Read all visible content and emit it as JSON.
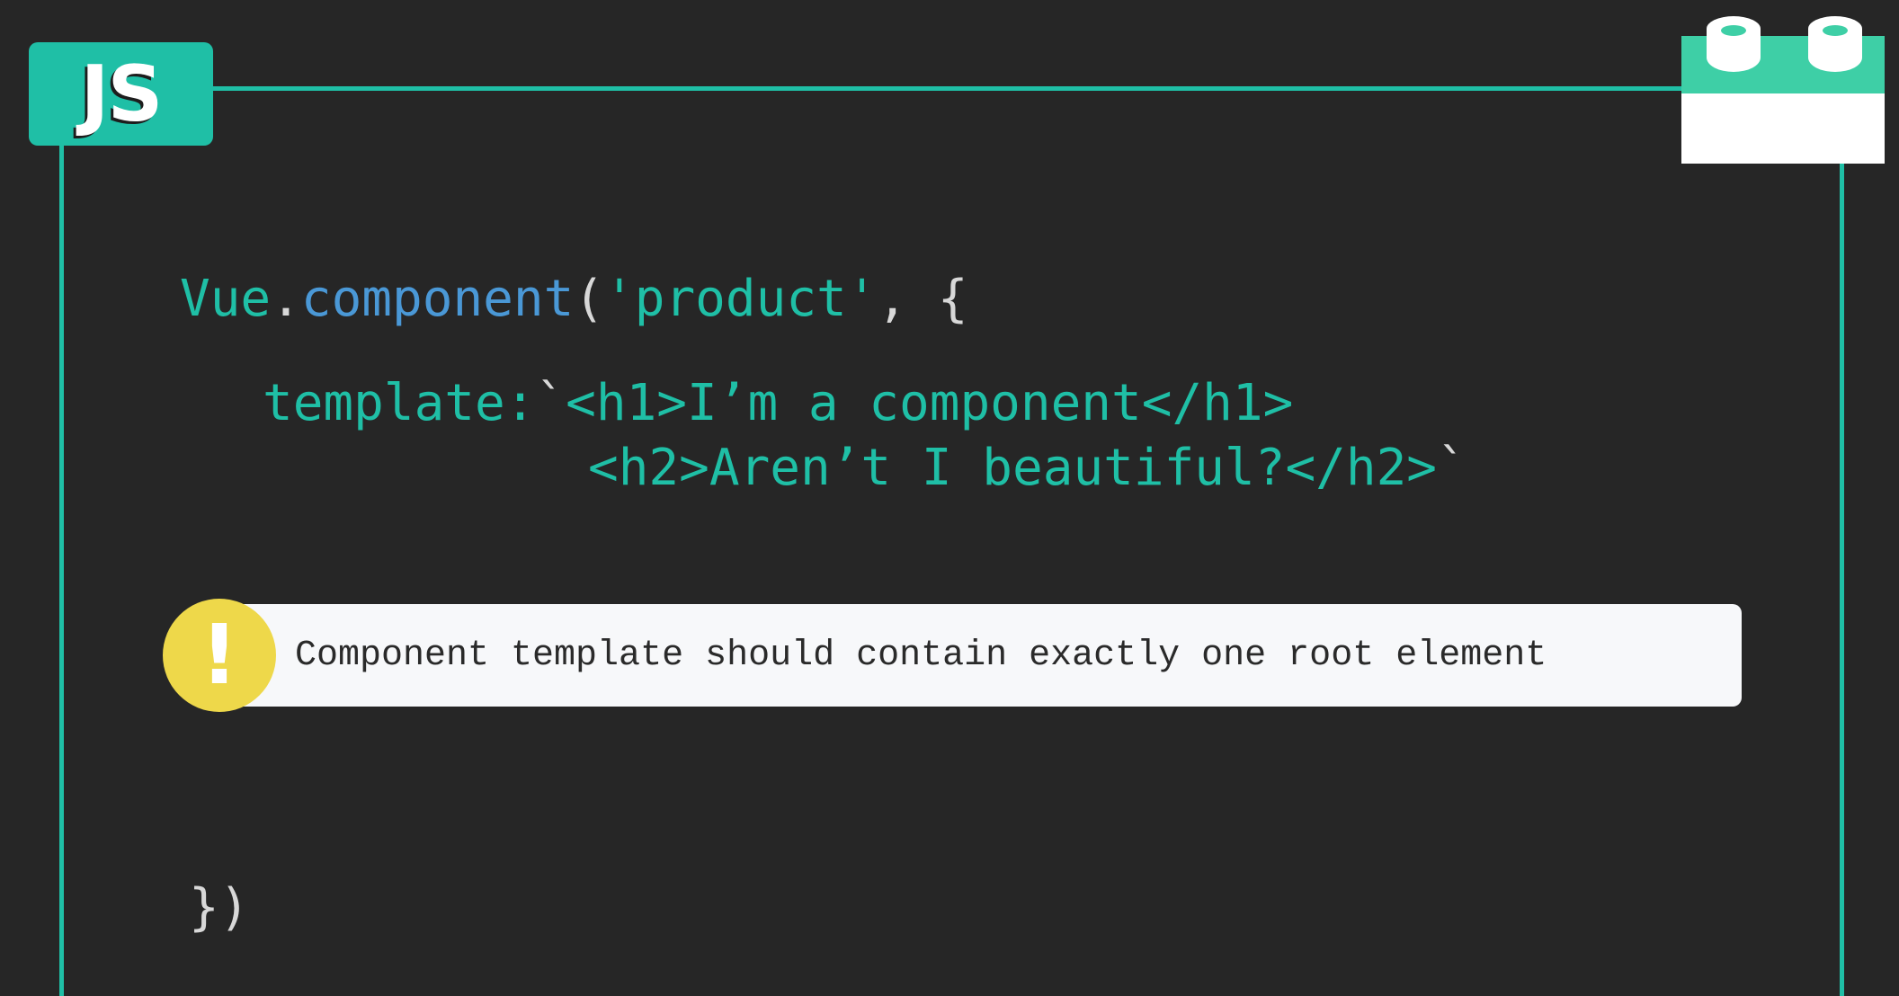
{
  "badge": {
    "label": "JS"
  },
  "code": {
    "line1": {
      "object": "Vue",
      "dot": ".",
      "method": "component",
      "open_paren": "(",
      "string": "'product'",
      "rest": ", {"
    },
    "line2": {
      "key": "template:",
      "tick": "`",
      "value": "<h1>I’m a component</h1>"
    },
    "line3": {
      "value": "<h2>Aren’t I beautiful?</h2>",
      "tick": "`"
    },
    "line4": "})"
  },
  "warning": {
    "icon": "exclamation-icon",
    "icon_glyph": "!",
    "message": "Component template should contain exactly one root element"
  },
  "colors": {
    "background": "#262626",
    "accent": "#1fbfa6",
    "method": "#4a98d6",
    "warning": "#eed84a"
  }
}
